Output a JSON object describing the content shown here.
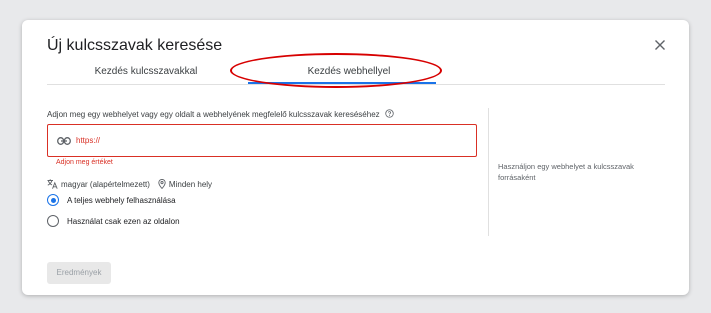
{
  "dialog": {
    "title": "Új kulcsszavak keresése",
    "close_icon": "close-icon"
  },
  "tabs": [
    {
      "label": "Kezdés kulcsszavakkal",
      "selected": false
    },
    {
      "label": "Kezdés webhellyel",
      "selected": true
    }
  ],
  "form": {
    "instruction": "Adjon meg egy webhelyet vagy egy oldalt a webhelyének megfelelő kulcsszavak kereséséhez",
    "help_icon": "help-circle-icon",
    "url_field": {
      "value": "https://",
      "icon": "link-icon"
    },
    "error": "Adjon meg értéket",
    "language": "magyar (alapértelmezett)",
    "location": "Minden hely",
    "radio_options": [
      {
        "label": "A teljes webhely felhasználása",
        "checked": true
      },
      {
        "label": "Használat csak ezen az oldalon",
        "checked": false
      }
    ],
    "results_button": "Eredmények"
  },
  "side_panel": {
    "text": "Használjon egy webhelyet a kulcsszavak forrásaként"
  },
  "colors": {
    "accent": "#1a73e8",
    "error": "#d93025",
    "annotation": "#d70000"
  }
}
